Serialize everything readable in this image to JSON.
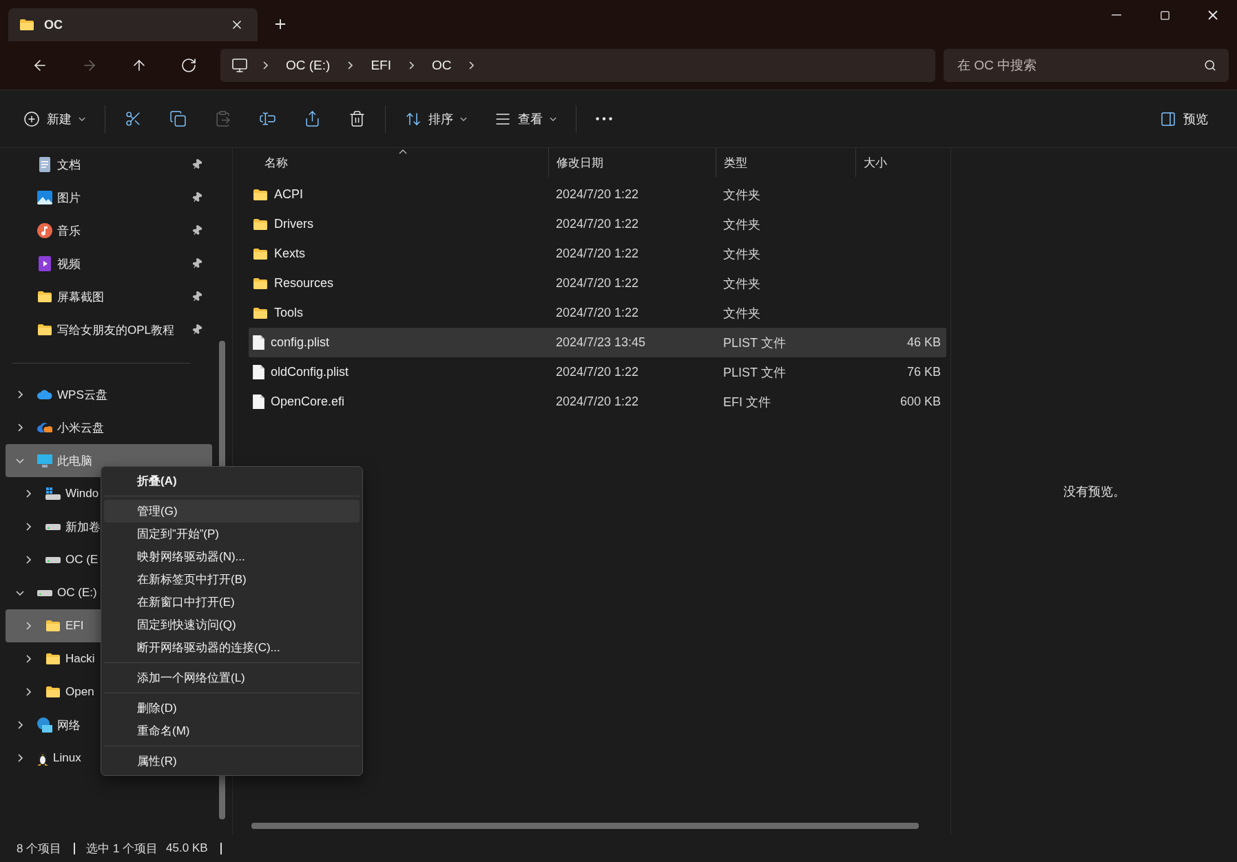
{
  "tab": {
    "title": "OC"
  },
  "nav": [
    {
      "kind": "back",
      "disabled": false
    },
    {
      "kind": "forward",
      "disabled": true
    },
    {
      "kind": "up",
      "disabled": false
    },
    {
      "kind": "refresh",
      "disabled": false
    }
  ],
  "breadcrumb": [
    "OC (E:)",
    "EFI",
    "OC"
  ],
  "search": {
    "placeholder": "在 OC 中搜索"
  },
  "toolbar": {
    "new": "新建",
    "actions": [
      {
        "kind": "cut",
        "disabled": false
      },
      {
        "kind": "copy",
        "disabled": false
      },
      {
        "kind": "paste",
        "disabled": true
      },
      {
        "kind": "rename",
        "disabled": false
      },
      {
        "kind": "share",
        "disabled": false
      },
      {
        "kind": "delete",
        "disabled": false
      }
    ],
    "sort": "排序",
    "view": "查看",
    "preview": "预览"
  },
  "sidebar": {
    "quick_access": [
      {
        "label": "文档",
        "kind": "documents",
        "pinned": true,
        "highlighted": false
      },
      {
        "label": "图片",
        "kind": "pictures",
        "pinned": true,
        "highlighted": false
      },
      {
        "label": "音乐",
        "kind": "music",
        "pinned": true,
        "highlighted": false
      },
      {
        "label": "视频",
        "kind": "videos",
        "pinned": true,
        "highlighted": false
      },
      {
        "label": "屏幕截图",
        "kind": "folder",
        "pinned": true,
        "highlighted": false
      },
      {
        "label": "写给女朋友的OPL教程",
        "kind": "folder",
        "pinned": true,
        "highlighted": false
      }
    ],
    "tree": [
      {
        "label": "WPS云盘",
        "kind": "cloud-blue",
        "expanded": false,
        "highlighted": false
      },
      {
        "label": "小米云盘",
        "kind": "cloud-orange",
        "expanded": false,
        "highlighted": false
      },
      {
        "label": "此电脑",
        "kind": "pc",
        "expanded": true,
        "highlighted": true,
        "children": [
          {
            "label": "Windo",
            "kind": "windows-drive",
            "expanded": false,
            "highlighted": false
          },
          {
            "label": "新加卷",
            "kind": "drive",
            "expanded": false,
            "highlighted": false
          },
          {
            "label": "OC (E",
            "kind": "drive",
            "expanded": false,
            "highlighted": false
          }
        ]
      },
      {
        "label": "OC (E:)",
        "kind": "drive",
        "expanded": true,
        "highlighted": false,
        "children": [
          {
            "label": "EFI",
            "kind": "folder",
            "expanded": false,
            "highlighted": true
          },
          {
            "label": "Hacki",
            "kind": "folder",
            "expanded": false,
            "highlighted": false
          },
          {
            "label": "Open",
            "kind": "folder",
            "expanded": false,
            "highlighted": false
          }
        ]
      },
      {
        "label": "网络",
        "kind": "network",
        "expanded": false,
        "highlighted": false
      },
      {
        "label": "Linux",
        "kind": "linux",
        "expanded": false,
        "highlighted": false
      }
    ]
  },
  "columns": [
    {
      "label": "名称",
      "sorted": true
    },
    {
      "label": "修改日期",
      "sorted": false
    },
    {
      "label": "类型",
      "sorted": false
    },
    {
      "label": "大小",
      "sorted": false
    }
  ],
  "files": [
    {
      "kind": "folder",
      "name": "ACPI",
      "modified": "2024/7/20 1:22",
      "type": "文件夹",
      "selected": false
    },
    {
      "kind": "folder",
      "name": "Drivers",
      "modified": "2024/7/20 1:22",
      "type": "文件夹",
      "selected": false
    },
    {
      "kind": "folder",
      "name": "Kexts",
      "modified": "2024/7/20 1:22",
      "type": "文件夹",
      "selected": false
    },
    {
      "kind": "folder",
      "name": "Resources",
      "modified": "2024/7/20 1:22",
      "type": "文件夹",
      "selected": false
    },
    {
      "kind": "folder",
      "name": "Tools",
      "modified": "2024/7/20 1:22",
      "type": "文件夹",
      "selected": false
    },
    {
      "kind": "file",
      "name": "config.plist",
      "modified": "2024/7/23 13:45",
      "type": "PLIST 文件",
      "size": "46 KB",
      "selected": true
    },
    {
      "kind": "file",
      "name": "oldConfig.plist",
      "modified": "2024/7/20 1:22",
      "type": "PLIST 文件",
      "size": "76 KB",
      "selected": false
    },
    {
      "kind": "file",
      "name": "OpenCore.efi",
      "modified": "2024/7/20 1:22",
      "type": "EFI 文件",
      "size": "600 KB",
      "selected": false
    }
  ],
  "preview": {
    "message": "没有预览。"
  },
  "status": {
    "count": "8 个项目",
    "selection": "选中 1 个项目",
    "selection_size": "45.0 KB"
  },
  "context_menu": {
    "groups": [
      [
        {
          "label": "折叠(A)",
          "default": true,
          "highlighted": false
        }
      ],
      [
        {
          "label": "管理(G)",
          "default": false,
          "highlighted": true
        },
        {
          "label": "固定到”开始”(P)",
          "default": false,
          "highlighted": false
        },
        {
          "label": "映射网络驱动器(N)...",
          "default": false,
          "highlighted": false
        },
        {
          "label": "在新标签页中打开(B)",
          "default": false,
          "highlighted": false
        },
        {
          "label": "在新窗口中打开(E)",
          "default": false,
          "highlighted": false
        },
        {
          "label": "固定到快速访问(Q)",
          "default": false,
          "highlighted": false
        },
        {
          "label": "断开网络驱动器的连接(C)...",
          "default": false,
          "highlighted": false
        }
      ],
      [
        {
          "label": "添加一个网络位置(L)",
          "default": false,
          "highlighted": false
        }
      ],
      [
        {
          "label": "删除(D)",
          "default": false,
          "highlighted": false
        },
        {
          "label": "重命名(M)",
          "default": false,
          "highlighted": false
        }
      ],
      [
        {
          "label": "属性(R)",
          "default": false,
          "highlighted": false
        }
      ]
    ]
  }
}
